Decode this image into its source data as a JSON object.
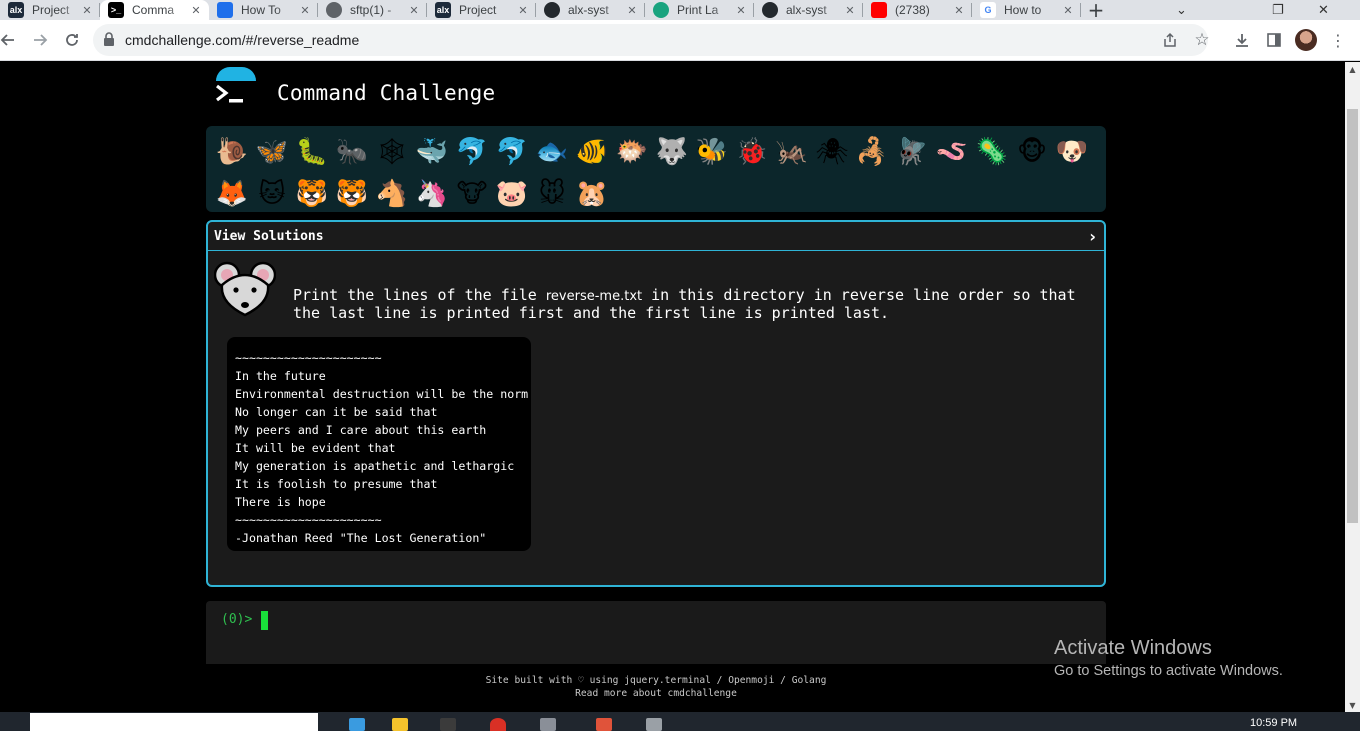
{
  "browser": {
    "tabs": [
      {
        "title": "Project",
        "favicon": "alx-icon",
        "fav_text": "alx",
        "active": false
      },
      {
        "title": "Comma",
        "favicon": "terminal-icon",
        "fav_text": ">_",
        "active": true
      },
      {
        "title": "How To",
        "favicon": "confluence-icon",
        "fav_text": "",
        "active": false
      },
      {
        "title": "sftp(1) -",
        "favicon": "globe-icon",
        "fav_text": "",
        "active": false
      },
      {
        "title": "Project",
        "favicon": "alx-icon",
        "fav_text": "alx",
        "active": false
      },
      {
        "title": "alx-syst",
        "favicon": "github-icon",
        "fav_text": "",
        "active": false
      },
      {
        "title": "Print La",
        "favicon": "chatgpt-icon",
        "fav_text": "",
        "active": false
      },
      {
        "title": "alx-syst",
        "favicon": "github-icon",
        "fav_text": "",
        "active": false
      },
      {
        "title": "(2738)",
        "favicon": "youtube-icon",
        "fav_text": "",
        "active": false
      },
      {
        "title": "How to",
        "favicon": "google-icon",
        "fav_text": "G",
        "active": false
      }
    ],
    "url": "cmdchallenge.com/#/reverse_readme",
    "new_tab": "+"
  },
  "site": {
    "title": "Command Challenge"
  },
  "emojis": [
    "🐌",
    "🦋",
    "🐛",
    "🐜",
    "🕸",
    "🐳",
    "🐬",
    "🐬",
    "🐟",
    "🐠",
    "🐡",
    "🐺",
    "🐝",
    "🐞",
    "🦗",
    "🕷",
    "🦂",
    "🪰",
    "🪱",
    "🦠",
    "🐵",
    "🐶",
    "🦊",
    "🐱",
    "🐯",
    "🐯",
    "🐴",
    "🦄",
    "🐮",
    "🐷",
    "🐭",
    "🐹"
  ],
  "challenge": {
    "solutions_label": "View Solutions",
    "chevron": "›",
    "task_before": "Print the lines of the file ",
    "task_file": "reverse-me.txt",
    "task_after": " in this directory in reverse line order so that the last line is printed first and the first line is printed last.",
    "file_lines": [
      "~~~~~~~~~~~~~~~~~~~~~",
      "In the future",
      "Environmental destruction will be the norm",
      "No longer can it be said that",
      "My peers and I care about this earth",
      "It will be evident that",
      "My generation is apathetic and lethargic",
      "It is foolish to presume that",
      "There is hope",
      "~~~~~~~~~~~~~~~~~~~~~",
      "-Jonathan Reed \"The Lost Generation\""
    ]
  },
  "terminal": {
    "prompt": "(0)> "
  },
  "footer": {
    "line1": "Site built with ♡ using jquery.terminal / Openmoji / Golang",
    "line2": "Read more about cmdchallenge"
  },
  "windows": {
    "activate_title": "Activate Windows",
    "activate_sub": "Go to Settings to activate Windows."
  },
  "taskbar": {
    "clock": "10:59 PM"
  },
  "colors": {
    "accent": "#2fb4d6",
    "prompt_green": "#2fbf4f",
    "panel_bg": "#0c262b"
  }
}
